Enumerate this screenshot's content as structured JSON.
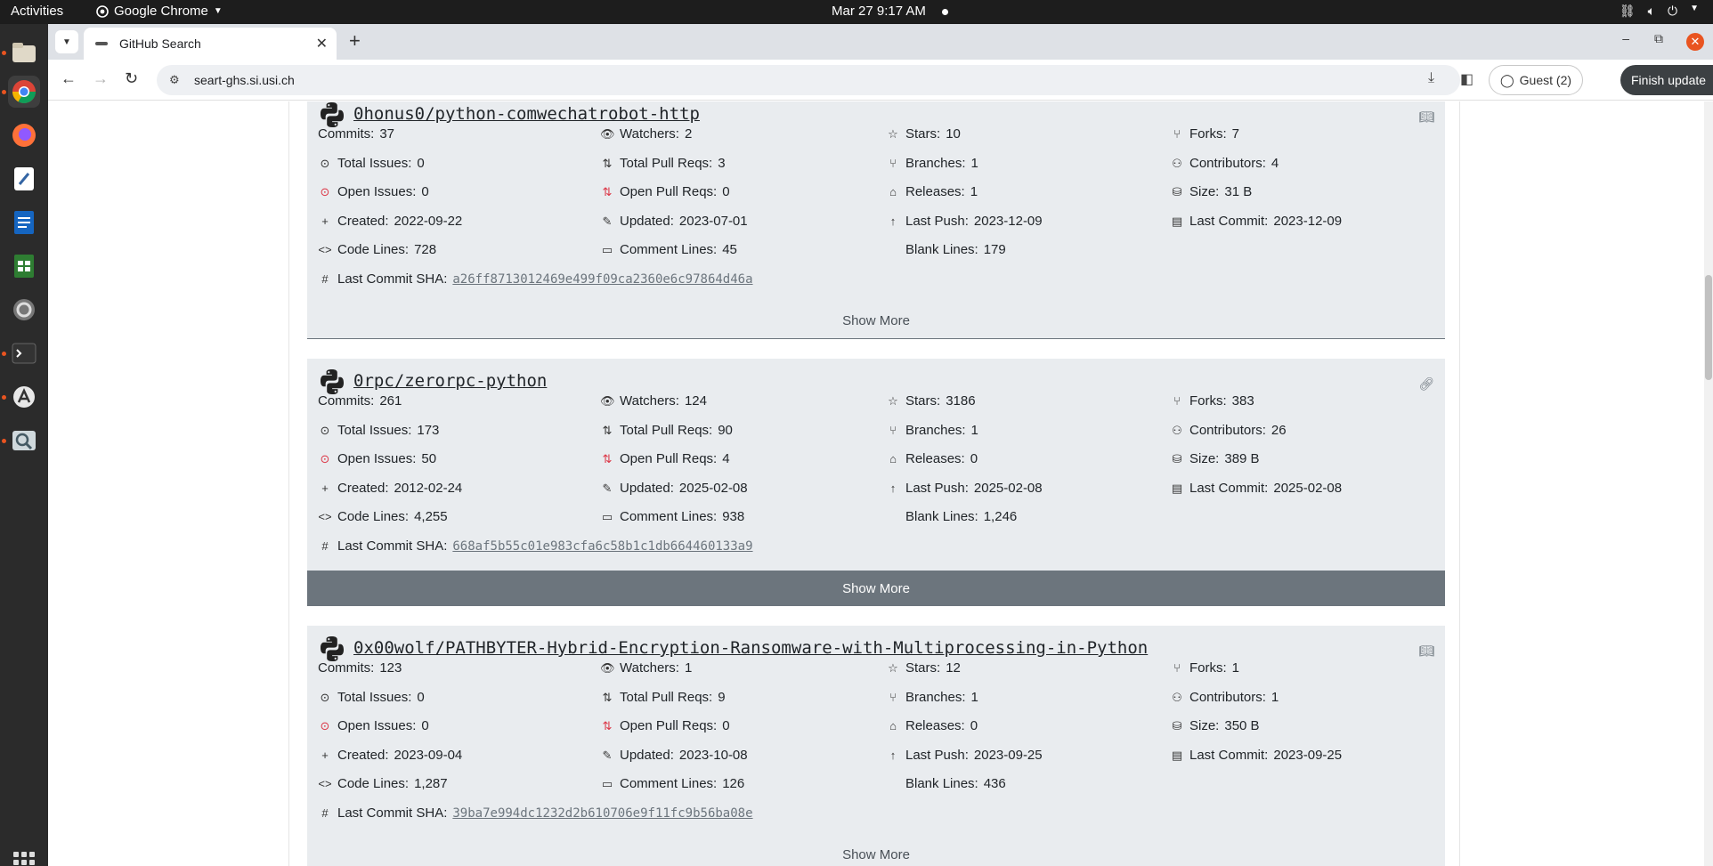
{
  "os": {
    "activities": "Activities",
    "app_name": "Google Chrome",
    "clock": "Mar 27  9:17 AM"
  },
  "browser": {
    "tab_title": "GitHub Search",
    "url": "seart-ghs.si.usi.ch",
    "profile": "Guest (2)",
    "update_button": "Finish update"
  },
  "labels": {
    "commits": "Commits:",
    "watchers": "Watchers:",
    "stars": "Stars:",
    "forks": "Forks:",
    "total_issues": "Total Issues:",
    "total_prs": "Total Pull Reqs:",
    "branches": "Branches:",
    "contributors": "Contributors:",
    "open_issues": "Open Issues:",
    "open_prs": "Open Pull Reqs:",
    "releases": "Releases:",
    "size": "Size:",
    "created": "Created:",
    "updated": "Updated:",
    "last_push": "Last Push:",
    "last_commit": "Last Commit:",
    "code_lines": "Code Lines:",
    "comment_lines": "Comment Lines:",
    "blank_lines": "Blank Lines:",
    "last_commit_sha": "Last Commit SHA:",
    "show_more": "Show More"
  },
  "repos": [
    {
      "name": "0honus0/python-comwechatrobot-http",
      "corner_icon": "book-icon",
      "commits": "37",
      "watchers": "2",
      "stars": "10",
      "forks": "7",
      "total_issues": "0",
      "total_prs": "3",
      "branches": "1",
      "contributors": "4",
      "open_issues": "0",
      "open_prs": "0",
      "releases": "1",
      "size": "31 B",
      "created": "2022-09-22",
      "updated": "2023-07-01",
      "last_push": "2023-12-09",
      "last_commit": "2023-12-09",
      "code_lines": "728",
      "comment_lines": "45",
      "blank_lines": "179",
      "sha": "a26ff8713012469e499f09ca2360e6c97864d46a"
    },
    {
      "name": "0rpc/zerorpc-python",
      "corner_icon": "link-icon",
      "commits": "261",
      "watchers": "124",
      "stars": "3186",
      "forks": "383",
      "total_issues": "173",
      "total_prs": "90",
      "branches": "1",
      "contributors": "26",
      "open_issues": "50",
      "open_prs": "4",
      "releases": "0",
      "size": "389 B",
      "created": "2012-02-24",
      "updated": "2025-02-08",
      "last_push": "2025-02-08",
      "last_commit": "2025-02-08",
      "code_lines": "4,255",
      "comment_lines": "938",
      "blank_lines": "1,246",
      "sha": "668af5b55c01e983cfa6c58b1c1db664460133a9"
    },
    {
      "name": "0x00wolf/PATHBYTER-Hybrid-Encryption-Ransomware-with-Multiprocessing-in-Python",
      "corner_icon": "book-icon",
      "commits": "123",
      "watchers": "1",
      "stars": "12",
      "forks": "1",
      "total_issues": "0",
      "total_prs": "9",
      "branches": "1",
      "contributors": "1",
      "open_issues": "0",
      "open_prs": "0",
      "releases": "0",
      "size": "350 B",
      "created": "2023-09-04",
      "updated": "2023-10-08",
      "last_push": "2023-09-25",
      "last_commit": "2023-09-25",
      "code_lines": "1,287",
      "comment_lines": "126",
      "blank_lines": "436",
      "sha": "39ba7e994dc1232d2b610706e9f11fc9b56ba08e"
    }
  ]
}
